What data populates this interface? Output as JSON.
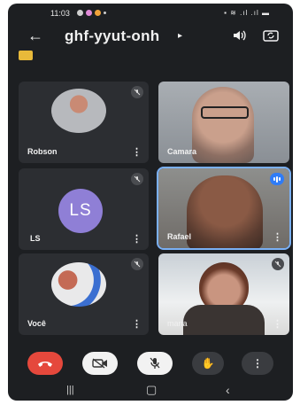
{
  "status": {
    "time": "11:03"
  },
  "meeting": {
    "title": "ghf-yyut-onh"
  },
  "participants": [
    {
      "name": "Robson"
    },
    {
      "name": "Camara"
    },
    {
      "name": "LS",
      "initials": "LS"
    },
    {
      "name": "Rafael"
    },
    {
      "name": "Você"
    },
    {
      "name": "maria"
    }
  ],
  "colors": {
    "background": "#1d1f22",
    "tile": "#2c2e32",
    "avatar_ls": "#8f7fd6",
    "end_call": "#e5483c",
    "speaking": "#2f7cf6",
    "chip": "#e8b93a"
  },
  "icons": {
    "back": "arrow-left-icon",
    "speaker": "speaker-icon",
    "switch_camera": "switch-camera-icon",
    "mic_off": "mic-off-icon",
    "end_call": "phone-hangup-icon",
    "camera_off": "camera-off-icon",
    "raise_hand": "hand-icon",
    "more": "more-vert-icon"
  }
}
